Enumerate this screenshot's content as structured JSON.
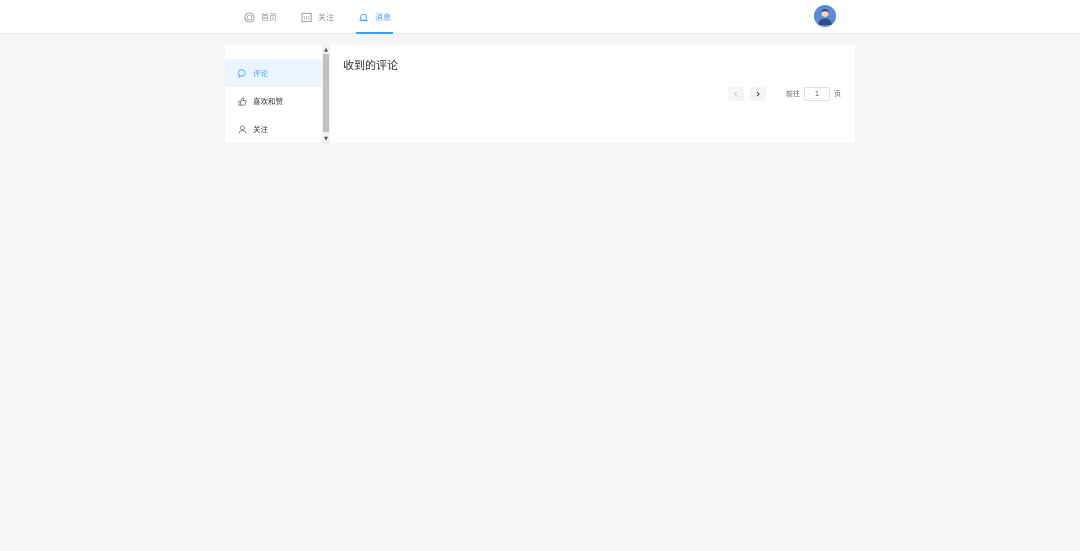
{
  "nav": {
    "items": [
      {
        "label": "首页",
        "icon": "globe-icon"
      },
      {
        "label": "关注",
        "icon": "calendar-icon"
      },
      {
        "label": "消息",
        "icon": "bell-icon",
        "active": true
      }
    ]
  },
  "sidebar": {
    "items": [
      {
        "label": "评论",
        "icon": "comment-icon",
        "active": true
      },
      {
        "label": "喜欢和赞",
        "icon": "thumbs-up-icon"
      },
      {
        "label": "关注",
        "icon": "user-icon"
      }
    ]
  },
  "content": {
    "title": "收到的评论"
  },
  "pager": {
    "goto_prefix": "前往",
    "page_value": "1",
    "goto_suffix": "页"
  },
  "colors": {
    "accent": "#409eff",
    "background": "#f5f5f5"
  }
}
